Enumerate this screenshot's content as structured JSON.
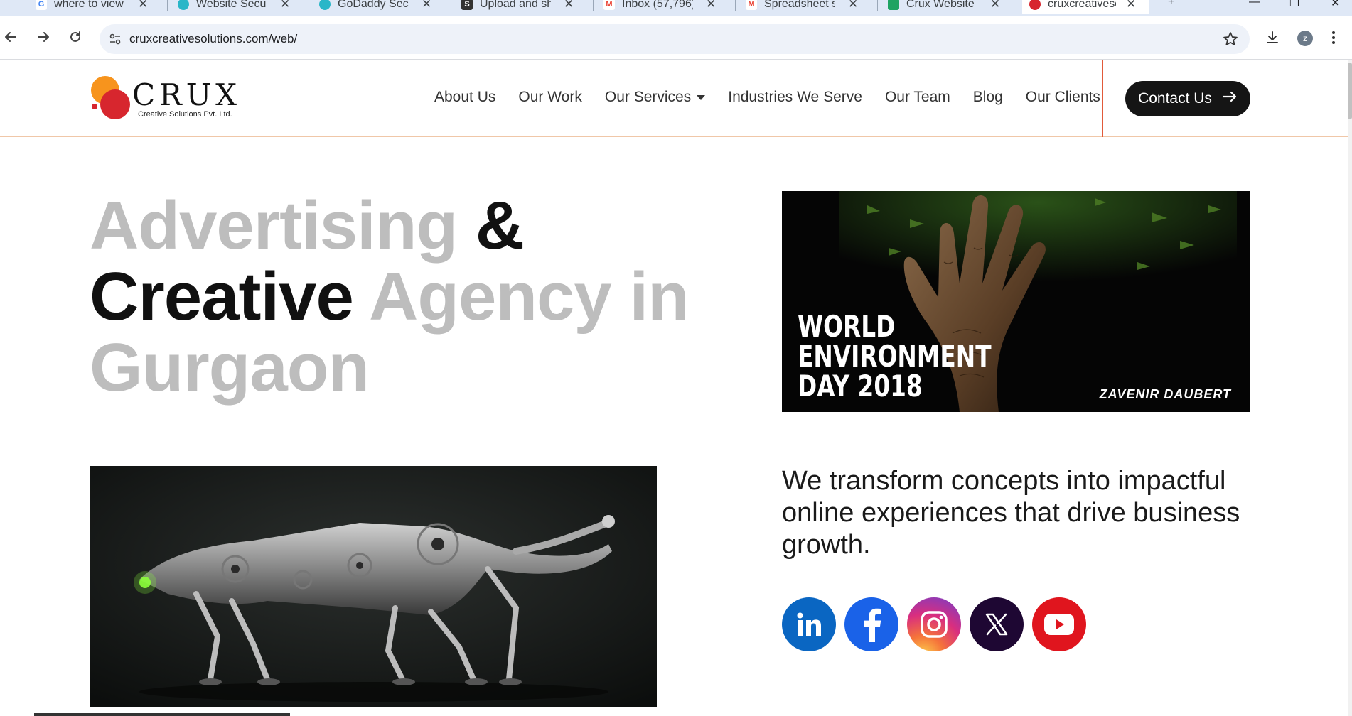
{
  "browser": {
    "tabs": [
      {
        "label": "where to view m",
        "favicon": "google-g"
      },
      {
        "label": "Website Security",
        "favicon": "sucuri"
      },
      {
        "label": "GoDaddy Securit",
        "favicon": "sucuri"
      },
      {
        "label": "Upload and shar",
        "favicon": "sb"
      },
      {
        "label": "Inbox (57,796) -",
        "favicon": "gmail"
      },
      {
        "label": "Spreadsheet sha",
        "favicon": "gmail"
      },
      {
        "label": "Crux Website pr",
        "favicon": "sheets"
      },
      {
        "label": "cruxcreativesolu",
        "favicon": "crux",
        "active": true
      }
    ],
    "url": "cruxcreativesolutions.com/web/",
    "profile_initial": "z"
  },
  "site": {
    "logo": {
      "name": "CRUX",
      "tagline": "Creative Solutions Pvt. Ltd."
    },
    "nav": [
      {
        "label": "About Us"
      },
      {
        "label": "Our Work"
      },
      {
        "label": "Our Services",
        "dropdown": true
      },
      {
        "label": "Industries We Serve"
      },
      {
        "label": "Our Team"
      },
      {
        "label": "Blog"
      },
      {
        "label": "Our Clients"
      }
    ],
    "contact_button": "Contact Us",
    "hero": {
      "w1": "Advertising",
      "w2": "&",
      "w3": "Creative",
      "w4": "Agency in",
      "w5": "Gurgaon"
    },
    "feature_image": {
      "line1": "WORLD",
      "line2": "ENVIRONMENT",
      "line3": "DAY 2018",
      "signature": "ZAVENIR DAUBERT"
    },
    "tagline": "We transform concepts into impactful online experiences that drive business growth.",
    "socials": [
      "linkedin",
      "facebook",
      "instagram",
      "x",
      "youtube"
    ]
  },
  "colors": {
    "accent_orange": "#f7941d",
    "accent_red": "#d7262e",
    "divider": "#e15a3a",
    "hero_grey": "#bdbdbd"
  }
}
